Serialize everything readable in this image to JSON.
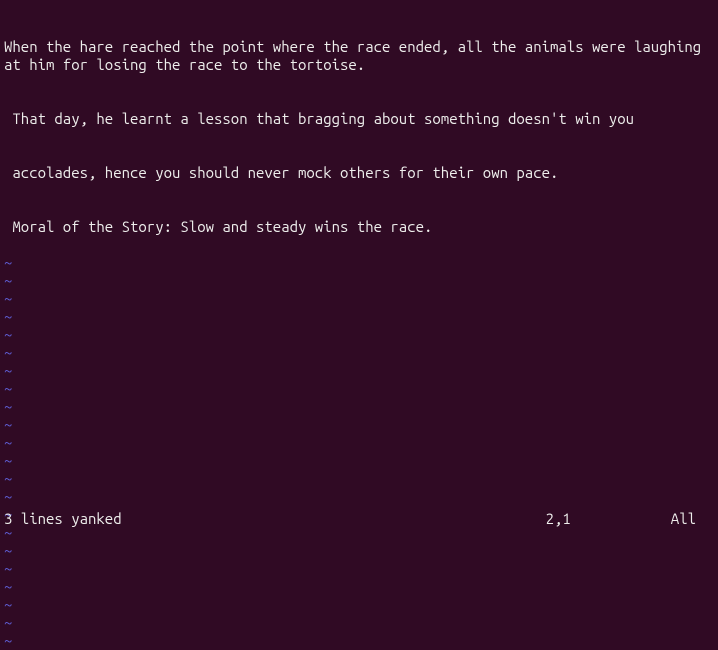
{
  "buffer": {
    "line1": "When the hare reached the point where the race ended, all the animals were laughing at him for losing the race to the tortoise.",
    "line2": " That day, he learnt a lesson that bragging about something doesn't win you",
    "line3": " accolades, hence you should never mock others for their own pace.",
    "line4": " Moral of the Story: Slow and steady wins the race."
  },
  "tilde": "~",
  "status": {
    "message": "3 lines yanked",
    "cursor": "2,1",
    "scroll": "All"
  }
}
